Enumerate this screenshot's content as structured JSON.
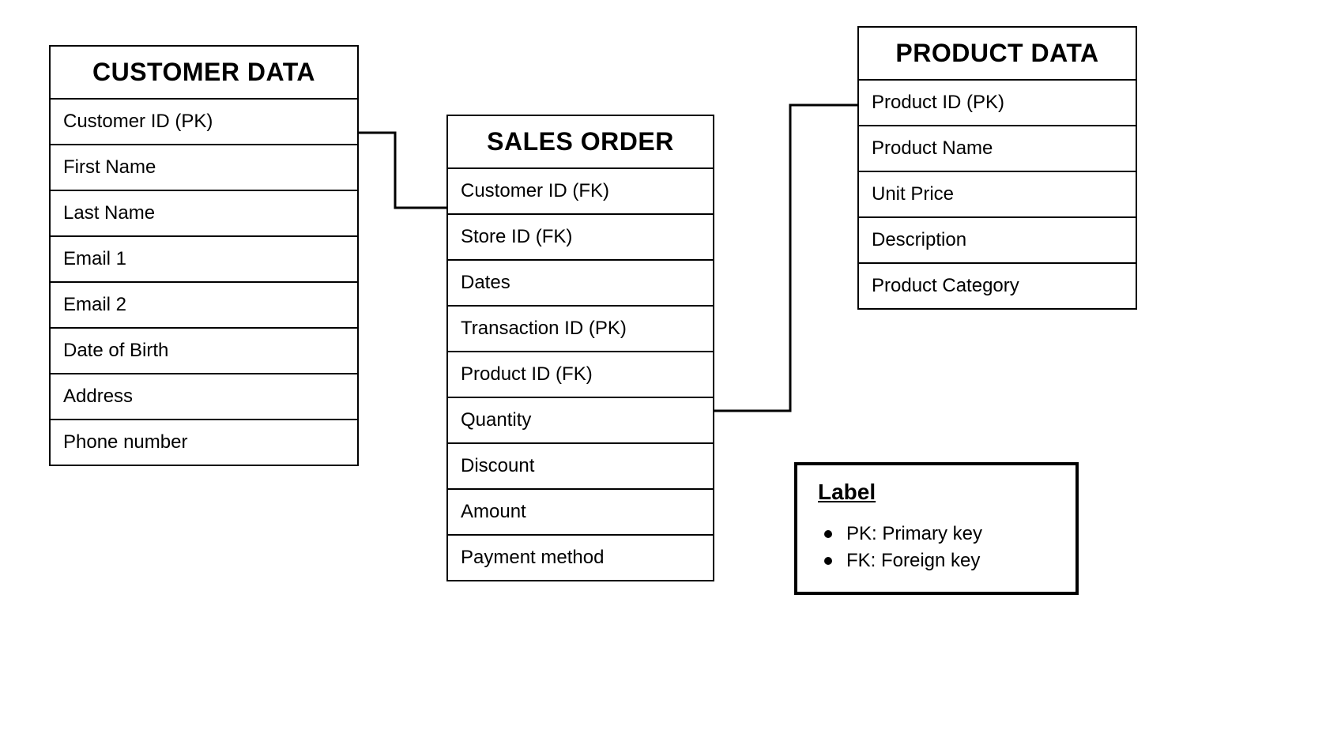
{
  "entities": {
    "customer": {
      "title": "CUSTOMER DATA",
      "fields": [
        "Customer ID (PK)",
        "First Name",
        "Last Name",
        "Email 1",
        "Email 2",
        "Date of Birth",
        "Address",
        "Phone number"
      ]
    },
    "sales": {
      "title": "SALES ORDER",
      "fields": [
        "Customer ID (FK)",
        "Store ID (FK)",
        "Dates",
        "Transaction ID (PK)",
        "Product ID (FK)",
        "Quantity",
        "Discount",
        "Amount",
        "Payment method"
      ]
    },
    "product": {
      "title": "PRODUCT DATA",
      "fields": [
        "Product ID (PK)",
        "Product Name",
        "Unit Price",
        "Description",
        "Product Category"
      ]
    }
  },
  "legend": {
    "title": "Label",
    "items": [
      "PK: Primary key",
      "FK: Foreign key"
    ]
  }
}
